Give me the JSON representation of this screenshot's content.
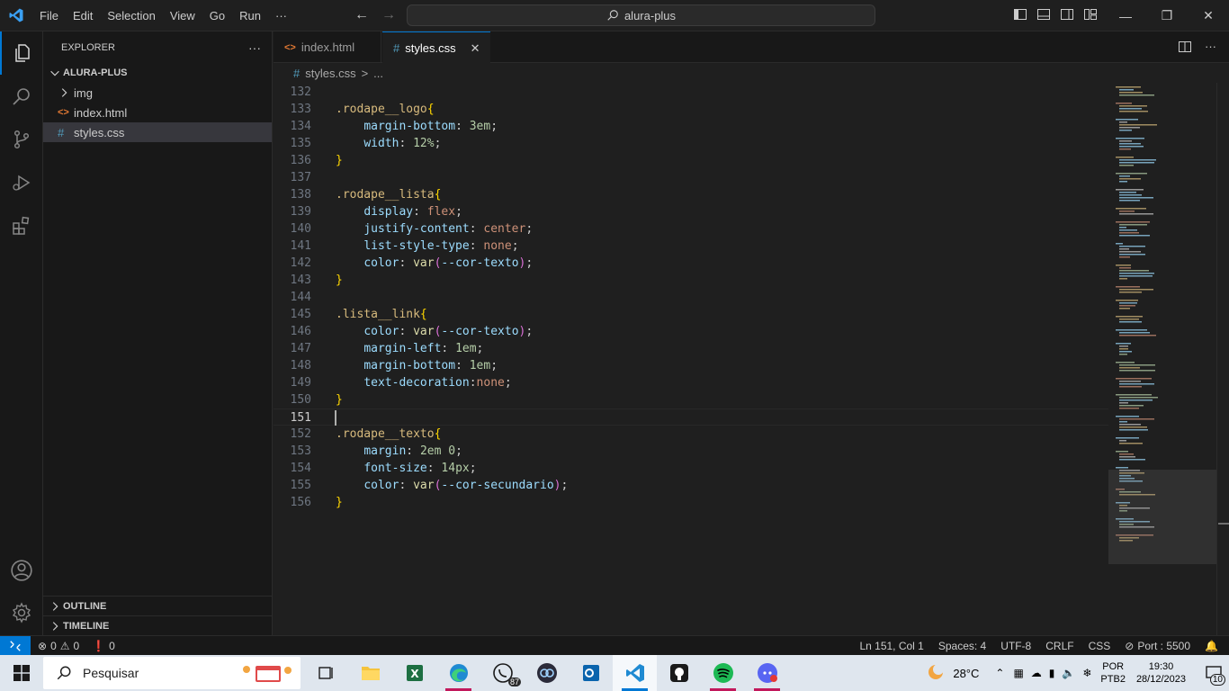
{
  "titlebar": {
    "menu": [
      "File",
      "Edit",
      "Selection",
      "View",
      "Go",
      "Run",
      "···"
    ],
    "search_text": "alura-plus"
  },
  "sidebar": {
    "header": "EXPLORER",
    "more": "···",
    "folder": "ALURA-PLUS",
    "items": [
      {
        "label": "img",
        "kind": "folder"
      },
      {
        "label": "index.html",
        "kind": "html"
      },
      {
        "label": "styles.css",
        "kind": "css"
      }
    ],
    "outline": "OUTLINE",
    "timeline": "TIMELINE"
  },
  "tabs": [
    {
      "label": "index.html",
      "icon": "<>"
    },
    {
      "label": "styles.css",
      "icon": "#"
    }
  ],
  "breadcrumb": {
    "file": "styles.css",
    "sep": ">",
    "rest": "..."
  },
  "editor": {
    "current_line": 151,
    "lines": [
      {
        "n": "132",
        "tokens": []
      },
      {
        "n": "133",
        "tokens": [
          [
            "sel",
            ".rodape__logo"
          ],
          [
            "brace",
            "{"
          ]
        ]
      },
      {
        "n": "134",
        "tokens": [
          [
            "plain",
            "    "
          ],
          [
            "prop",
            "margin-bottom"
          ],
          [
            "plain",
            ": "
          ],
          [
            "num",
            "3em"
          ],
          [
            "plain",
            ";"
          ]
        ]
      },
      {
        "n": "135",
        "tokens": [
          [
            "plain",
            "    "
          ],
          [
            "prop",
            "width"
          ],
          [
            "plain",
            ": "
          ],
          [
            "num",
            "12%"
          ],
          [
            "plain",
            ";"
          ]
        ]
      },
      {
        "n": "136",
        "tokens": [
          [
            "brace",
            "}"
          ]
        ]
      },
      {
        "n": "137",
        "tokens": []
      },
      {
        "n": "138",
        "tokens": [
          [
            "sel",
            ".rodape__lista"
          ],
          [
            "brace",
            "{"
          ]
        ]
      },
      {
        "n": "139",
        "tokens": [
          [
            "plain",
            "    "
          ],
          [
            "prop",
            "display"
          ],
          [
            "plain",
            ": "
          ],
          [
            "val",
            "flex"
          ],
          [
            "plain",
            ";"
          ]
        ]
      },
      {
        "n": "140",
        "tokens": [
          [
            "plain",
            "    "
          ],
          [
            "prop",
            "justify-content"
          ],
          [
            "plain",
            ": "
          ],
          [
            "val",
            "center"
          ],
          [
            "plain",
            ";"
          ]
        ]
      },
      {
        "n": "141",
        "tokens": [
          [
            "plain",
            "    "
          ],
          [
            "prop",
            "list-style-type"
          ],
          [
            "plain",
            ": "
          ],
          [
            "val",
            "none"
          ],
          [
            "plain",
            ";"
          ]
        ]
      },
      {
        "n": "142",
        "tokens": [
          [
            "plain",
            "    "
          ],
          [
            "prop",
            "color"
          ],
          [
            "plain",
            ": "
          ],
          [
            "fn",
            "var"
          ],
          [
            "paren",
            "("
          ],
          [
            "prop",
            "--cor-texto"
          ],
          [
            "paren",
            ")"
          ],
          [
            "plain",
            ";"
          ]
        ]
      },
      {
        "n": "143",
        "tokens": [
          [
            "brace",
            "}"
          ]
        ]
      },
      {
        "n": "144",
        "tokens": []
      },
      {
        "n": "145",
        "tokens": [
          [
            "sel",
            ".lista__link"
          ],
          [
            "brace",
            "{"
          ]
        ]
      },
      {
        "n": "146",
        "tokens": [
          [
            "plain",
            "    "
          ],
          [
            "prop",
            "color"
          ],
          [
            "plain",
            ": "
          ],
          [
            "fn",
            "var"
          ],
          [
            "paren",
            "("
          ],
          [
            "prop",
            "--cor-texto"
          ],
          [
            "paren",
            ")"
          ],
          [
            "plain",
            ";"
          ]
        ]
      },
      {
        "n": "147",
        "tokens": [
          [
            "plain",
            "    "
          ],
          [
            "prop",
            "margin-left"
          ],
          [
            "plain",
            ": "
          ],
          [
            "num",
            "1em"
          ],
          [
            "plain",
            ";"
          ]
        ]
      },
      {
        "n": "148",
        "tokens": [
          [
            "plain",
            "    "
          ],
          [
            "prop",
            "margin-bottom"
          ],
          [
            "plain",
            ": "
          ],
          [
            "num",
            "1em"
          ],
          [
            "plain",
            ";"
          ]
        ]
      },
      {
        "n": "149",
        "tokens": [
          [
            "plain",
            "    "
          ],
          [
            "prop",
            "text-decoration"
          ],
          [
            "plain",
            ":"
          ],
          [
            "val",
            "none"
          ],
          [
            "plain",
            ";"
          ]
        ]
      },
      {
        "n": "150",
        "tokens": [
          [
            "brace",
            "}"
          ]
        ]
      },
      {
        "n": "151",
        "tokens": []
      },
      {
        "n": "152",
        "tokens": [
          [
            "sel",
            ".rodape__texto"
          ],
          [
            "brace",
            "{"
          ]
        ]
      },
      {
        "n": "153",
        "tokens": [
          [
            "plain",
            "    "
          ],
          [
            "prop",
            "margin"
          ],
          [
            "plain",
            ": "
          ],
          [
            "num",
            "2em 0"
          ],
          [
            "plain",
            ";"
          ]
        ]
      },
      {
        "n": "154",
        "tokens": [
          [
            "plain",
            "    "
          ],
          [
            "prop",
            "font-size"
          ],
          [
            "plain",
            ": "
          ],
          [
            "num",
            "14px"
          ],
          [
            "plain",
            ";"
          ]
        ]
      },
      {
        "n": "155",
        "tokens": [
          [
            "plain",
            "    "
          ],
          [
            "prop",
            "color"
          ],
          [
            "plain",
            ": "
          ],
          [
            "fn",
            "var"
          ],
          [
            "paren",
            "("
          ],
          [
            "prop",
            "--cor-secundario"
          ],
          [
            "paren",
            ")"
          ],
          [
            "plain",
            ";"
          ]
        ]
      },
      {
        "n": "156",
        "tokens": [
          [
            "brace",
            "}"
          ]
        ]
      }
    ]
  },
  "statusbar": {
    "errors": "0",
    "warnings": "0",
    "ports": "0",
    "position": "Ln 151, Col 1",
    "spaces": "Spaces: 4",
    "encoding": "UTF-8",
    "eol": "CRLF",
    "language": "CSS",
    "port": "Port : 5500"
  },
  "taskbar": {
    "search_placeholder": "Pesquisar",
    "whatsapp_badge": "87",
    "weather": "28°C",
    "lang_top": "POR",
    "lang_bottom": "PTB2",
    "time": "19:30",
    "date": "28/12/2023",
    "notifications": "10"
  },
  "colors": {
    "accent": "#0078d4",
    "selector": "#d7ba7d",
    "brace": "#ffd700",
    "property": "#9cdcfe",
    "number": "#b5cea8",
    "value": "#ce9178"
  }
}
